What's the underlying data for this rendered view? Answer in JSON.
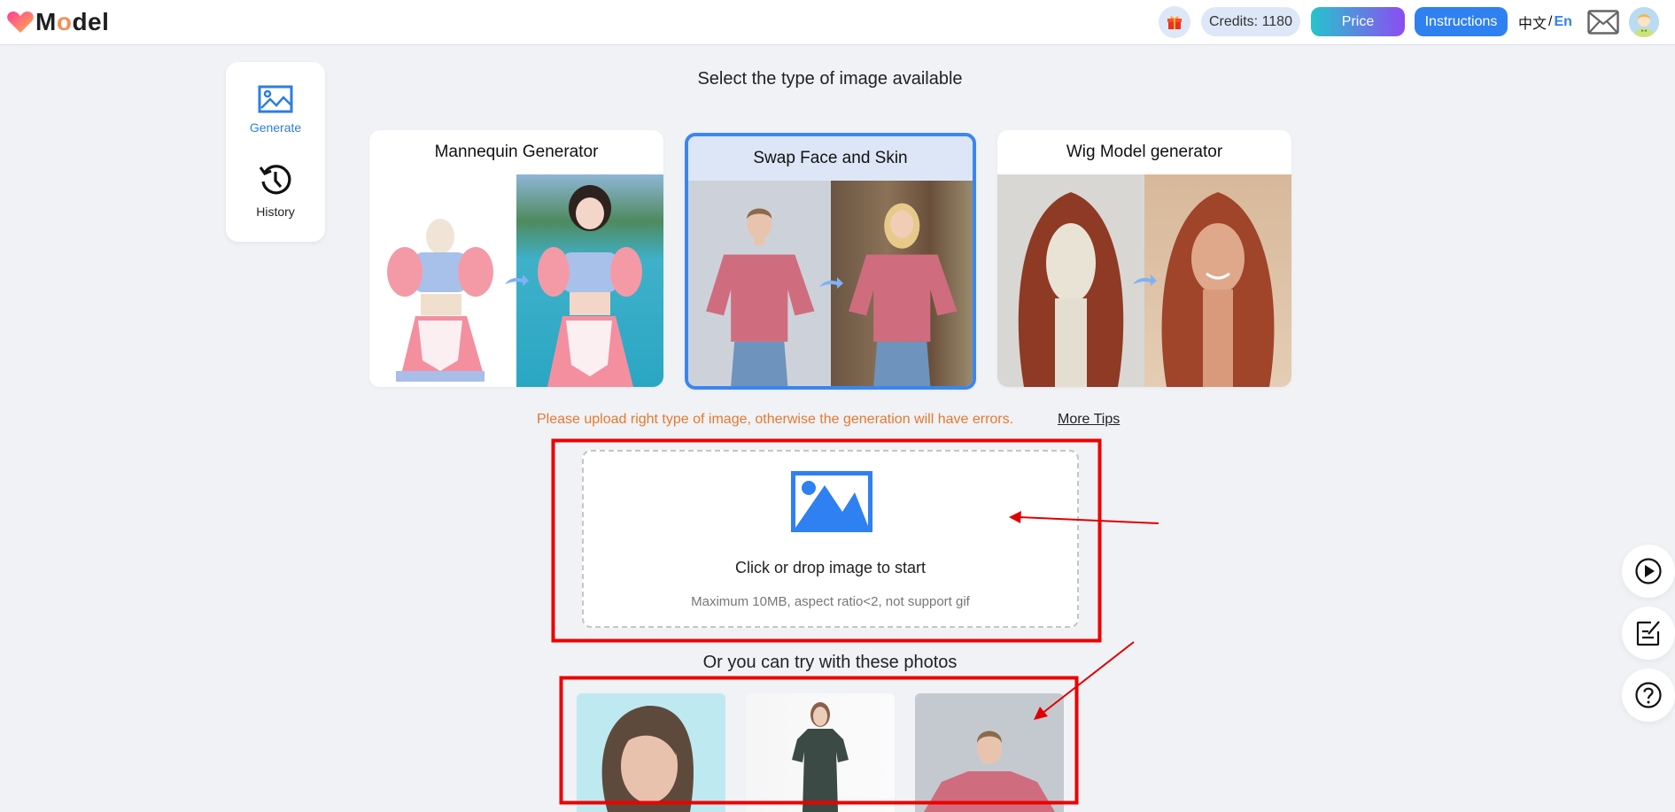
{
  "header": {
    "logo_prefix": "M",
    "logo_o": "o",
    "logo_suffix": "del",
    "credits_label": "Credits: 1180",
    "price_label": "Price",
    "instructions_label": "Instructions",
    "lang_zh": "中文",
    "lang_sep": "/",
    "lang_en": "En",
    "icons": {
      "gift": "gift-icon",
      "mail": "mail-icon",
      "avatar": "user-avatar"
    }
  },
  "sidebar": {
    "items": [
      {
        "label": "Generate",
        "icon": "image-icon",
        "active": true
      },
      {
        "label": "History",
        "icon": "history-icon",
        "active": false
      }
    ]
  },
  "main": {
    "title": "Select the type of image available",
    "types": [
      {
        "label": "Mannequin Generator",
        "selected": false
      },
      {
        "label": "Swap Face and Skin",
        "selected": true
      },
      {
        "label": "Wig Model generator",
        "selected": false
      }
    ],
    "tip": "Please upload right type of image, otherwise the generation will have errors.",
    "more_tips": "More Tips",
    "upload": {
      "title": "Click or drop image to start",
      "subtitle": "Maximum 10MB, aspect ratio<2, not support gif"
    },
    "samples_title": "Or you can try with these photos",
    "samples": [
      {
        "desc": "woman portrait on light blue background"
      },
      {
        "desc": "model in dark green shirt dress"
      },
      {
        "desc": "woman in pink oversized t-shirt"
      }
    ]
  },
  "floating_buttons": [
    {
      "icon": "play-icon"
    },
    {
      "icon": "feedback-icon"
    },
    {
      "icon": "help-icon"
    }
  ],
  "colors": {
    "accent": "#2f80f0",
    "tip": "#e6782e",
    "annotation": "#ee0000",
    "selected_card_bg": "#dde6f6"
  }
}
